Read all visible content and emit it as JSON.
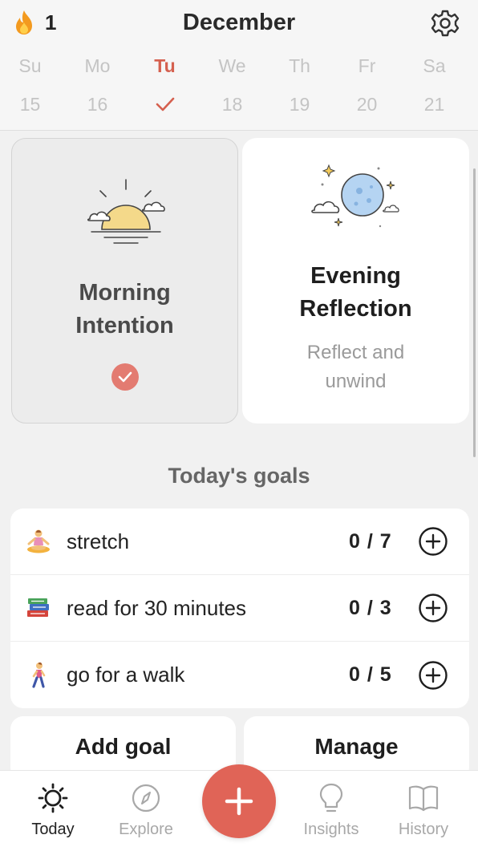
{
  "header": {
    "streak_icon": "flame-icon",
    "streak_count": "1",
    "month": "December",
    "settings_icon": "gear-icon"
  },
  "week": [
    {
      "name": "Su",
      "num": "15"
    },
    {
      "name": "Mo",
      "num": "16"
    },
    {
      "name": "Tu",
      "num": "",
      "completed": true
    },
    {
      "name": "We",
      "num": "18"
    },
    {
      "name": "Th",
      "num": "19"
    },
    {
      "name": "Fr",
      "num": "20"
    },
    {
      "name": "Sa",
      "num": "21"
    }
  ],
  "cards": {
    "morning": {
      "title_line1": "Morning",
      "title_line2": "Intention",
      "icon": "sunrise-icon",
      "status_icon": "check-icon"
    },
    "evening": {
      "title_line1": "Evening",
      "title_line2": "Reflection",
      "sub_line1": "Reflect and",
      "sub_line2": "unwind",
      "icon": "moon-icon"
    }
  },
  "goals": {
    "heading": "Today's goals",
    "items": [
      {
        "emoji": "yoga-icon",
        "label": "stretch",
        "count": "0 / 7"
      },
      {
        "emoji": "books-icon",
        "label": "read for 30 minutes",
        "count": "0 / 3"
      },
      {
        "emoji": "walking-icon",
        "label": "go for a walk",
        "count": "0 / 5"
      }
    ],
    "add_label": "Add goal",
    "manage_label": "Manage"
  },
  "tabbar": {
    "today": "Today",
    "explore": "Explore",
    "insights": "Insights",
    "history": "History"
  },
  "colors": {
    "accent": "#e06457",
    "today_text": "#d5604f"
  }
}
